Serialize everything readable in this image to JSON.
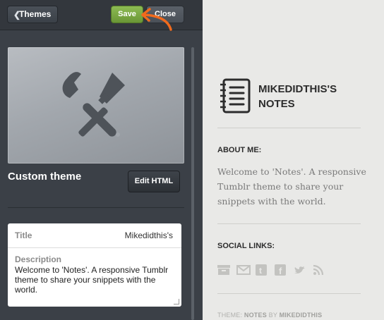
{
  "toolbar": {
    "themes_label": "Themes",
    "save_label": "Save",
    "close_label": "Close"
  },
  "theme": {
    "name": "Custom theme",
    "edit_html_label": "Edit HTML"
  },
  "fields": {
    "title_label": "Title",
    "title_value": "Mikedidthis's",
    "description_label": "Description",
    "description_value": "Welcome to 'Notes'. A responsive Tumblr theme to share your snippets with the world."
  },
  "preview": {
    "blog_title_line1": "MIKEDIDTHIS'S",
    "blog_title_line2": "NOTES",
    "about_heading": "ABOUT ME:",
    "about_text": "Welcome to 'Notes'. A responsive Tumblr theme to share your snippets with the world.",
    "social_heading": "SOCIAL LINKS:",
    "social_icons": [
      "archive-icon",
      "mail-icon",
      "tumblr-icon",
      "facebook-icon",
      "twitter-icon",
      "rss-icon"
    ],
    "footer_prefix": "THEME: ",
    "footer_theme": "NOTES",
    "footer_by": " BY ",
    "footer_author": "MIKEDIDTHIS"
  },
  "colors": {
    "panel_bg": "#3b4047",
    "save_green": "#7aa843",
    "annotation_arrow": "#f06a1d",
    "preview_bg": "#e9e9e7"
  }
}
